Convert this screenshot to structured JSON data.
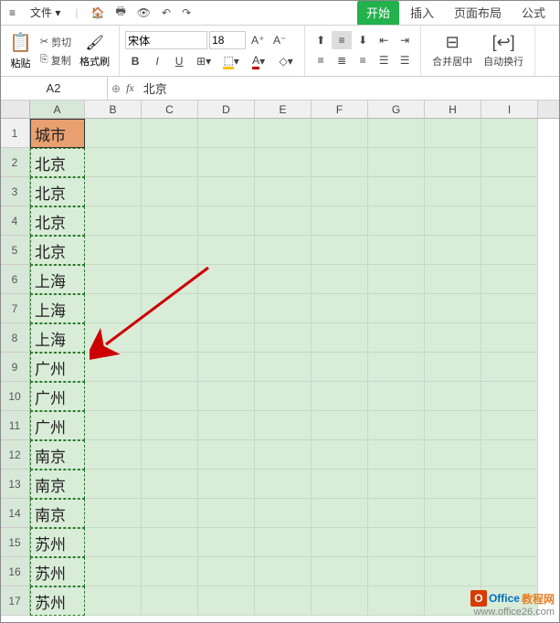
{
  "menubar": {
    "file_label": "文件"
  },
  "tabs": {
    "start": "开始",
    "insert": "插入",
    "page_layout": "页面布局",
    "formula": "公式"
  },
  "clipboard": {
    "paste": "粘贴",
    "cut": "剪切",
    "copy": "复制",
    "format_painter": "格式刷"
  },
  "font": {
    "name": "宋体",
    "size": "18"
  },
  "merge": {
    "label": "合并居中"
  },
  "wrap": {
    "label": "自动换行"
  },
  "formula_bar": {
    "name_box": "A2",
    "fx": "fx",
    "value": "北京"
  },
  "columns": [
    "A",
    "B",
    "C",
    "D",
    "E",
    "F",
    "G",
    "H",
    "I"
  ],
  "rows": [
    {
      "n": "1",
      "val": "城市"
    },
    {
      "n": "2",
      "val": "北京"
    },
    {
      "n": "3",
      "val": "北京"
    },
    {
      "n": "4",
      "val": "北京"
    },
    {
      "n": "5",
      "val": "北京"
    },
    {
      "n": "6",
      "val": "上海"
    },
    {
      "n": "7",
      "val": "上海"
    },
    {
      "n": "8",
      "val": "上海"
    },
    {
      "n": "9",
      "val": "广州"
    },
    {
      "n": "10",
      "val": "广州"
    },
    {
      "n": "11",
      "val": "广州"
    },
    {
      "n": "12",
      "val": "南京"
    },
    {
      "n": "13",
      "val": "南京"
    },
    {
      "n": "14",
      "val": "南京"
    },
    {
      "n": "15",
      "val": "苏州"
    },
    {
      "n": "16",
      "val": "苏州"
    },
    {
      "n": "17",
      "val": "苏州"
    }
  ],
  "watermark": {
    "brand1": "Office",
    "brand2": "教程网",
    "url": "www.office26.com"
  }
}
